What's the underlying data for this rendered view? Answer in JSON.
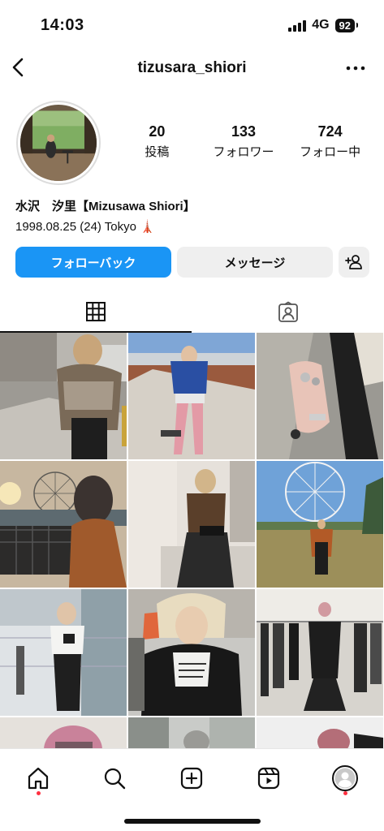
{
  "status_bar": {
    "time": "14:03",
    "network": "4G",
    "battery": "92"
  },
  "header": {
    "username": "tizusara_shiori",
    "back_icon": "chevron-left-icon",
    "more_icon": "more-horizontal-icon"
  },
  "stats": [
    {
      "value": "20",
      "label": "投稿"
    },
    {
      "value": "133",
      "label": "フォロワー"
    },
    {
      "value": "724",
      "label": "フォロー中"
    }
  ],
  "bio": {
    "name": "水沢　汐里【Mizusawa Shiori】",
    "line": "1998.08.25 (24) Tokyo 🗼"
  },
  "actions": {
    "follow_back": "フォローバック",
    "message": "メッセージ",
    "add_person_icon": "add-person-icon"
  },
  "tabs": [
    {
      "icon": "grid-icon",
      "active": true
    },
    {
      "icon": "tagged-person-icon",
      "active": false
    }
  ],
  "posts_count_visible": 12,
  "tabbar": [
    {
      "icon": "home-icon",
      "dot": true
    },
    {
      "icon": "search-icon",
      "dot": false
    },
    {
      "icon": "create-post-icon",
      "dot": false
    },
    {
      "icon": "reels-icon",
      "dot": false
    },
    {
      "icon": "profile-avatar-icon",
      "dot": true
    }
  ],
  "colors": {
    "primary_button": "#1a95f5",
    "secondary_button": "#efefef",
    "notification_dot": "#ff3040"
  }
}
